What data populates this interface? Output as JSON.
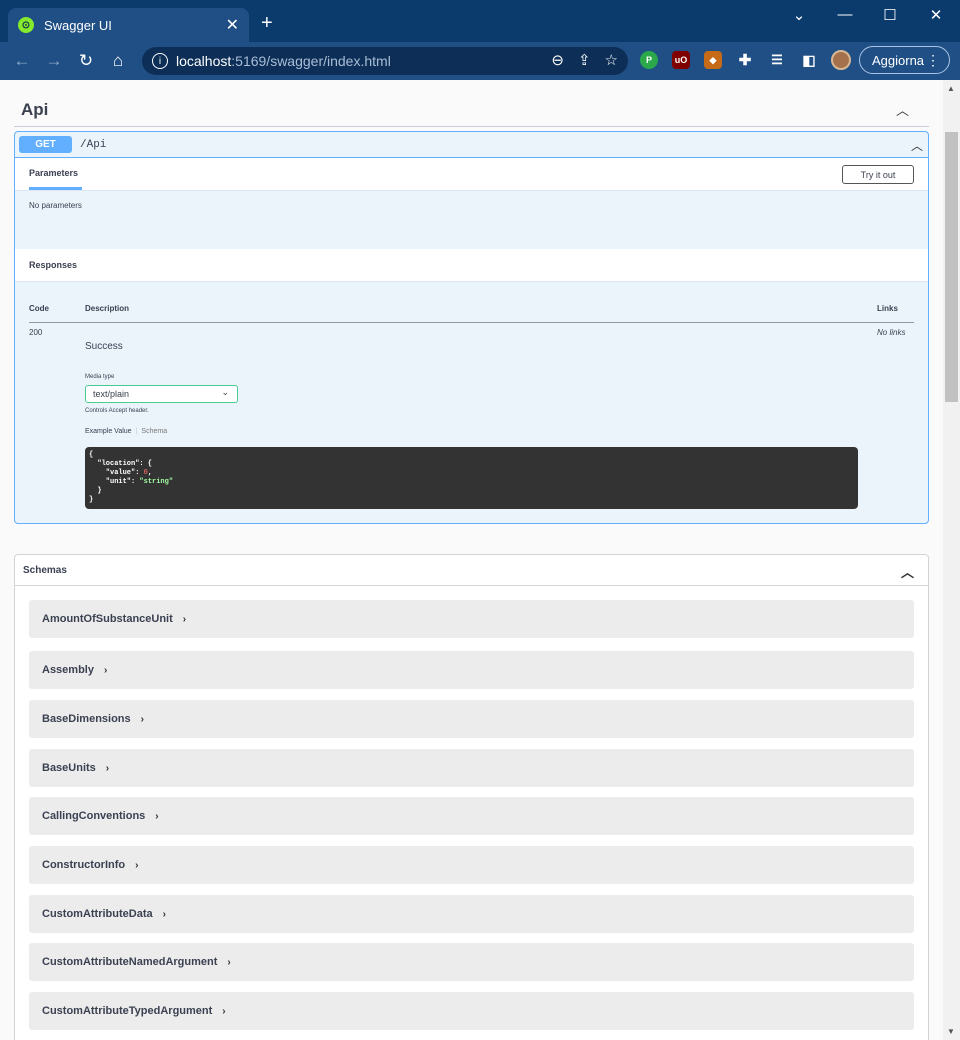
{
  "browser": {
    "tab_title": "Swagger UI",
    "tab_close": "✕",
    "new_tab": "+",
    "window_controls": {
      "chevron": "⌄",
      "minimize": "—",
      "maximize": "☐",
      "close": "✕"
    },
    "nav": {
      "back": "←",
      "forward": "→",
      "reload": "↻",
      "home": "⌂"
    },
    "url_host": "localhost",
    "url_path": ":5169/swagger/index.html",
    "update_label": "Aggiorna",
    "menu_dots": "⋮",
    "extensions": [
      {
        "name": "extension-green",
        "glyph": "P",
        "color": "#2aa84a"
      },
      {
        "name": "ublock",
        "glyph": "uO",
        "color": "#800000"
      },
      {
        "name": "extension-brown",
        "glyph": "◆",
        "color": "#c56a16"
      }
    ]
  },
  "api": {
    "title": "Api",
    "collapse": "︿"
  },
  "operation": {
    "method": "GET",
    "path": "/Api",
    "collapse": "︿",
    "params_tab": "Parameters",
    "try_button": "Try it out",
    "no_params": "No parameters",
    "responses_title": "Responses",
    "col_code": "Code",
    "col_desc": "Description",
    "col_links": "Links",
    "code": "200",
    "description": "Success",
    "links": "No links",
    "media_type_label": "Media type",
    "media_type": "text/plain",
    "media_arrow": "⌄",
    "controls_note": "Controls Accept header.",
    "example_tab": "Example Value",
    "schema_tab": "Schema",
    "sep": "|",
    "example": {
      "l1": "{",
      "l2": "  \"location\": {",
      "l3_key": "    \"value\": ",
      "l3_val": "0",
      "l3_end": ",",
      "l4_key": "    \"unit\": ",
      "l4_val": "\"string\"",
      "l5": "  }",
      "l6": "}"
    }
  },
  "schemas": {
    "title": "Schemas",
    "collapse": "︿",
    "items": [
      "AmountOfSubstanceUnit",
      "Assembly",
      "BaseDimensions",
      "BaseUnits",
      "CallingConventions",
      "ConstructorInfo",
      "CustomAttributeData",
      "CustomAttributeNamedArgument",
      "CustomAttributeTypedArgument"
    ],
    "expand_glyph": "›"
  },
  "colors": {
    "get": "#61affe",
    "chrome": "#0b3a6d",
    "toolbar": "#1f4f85"
  }
}
